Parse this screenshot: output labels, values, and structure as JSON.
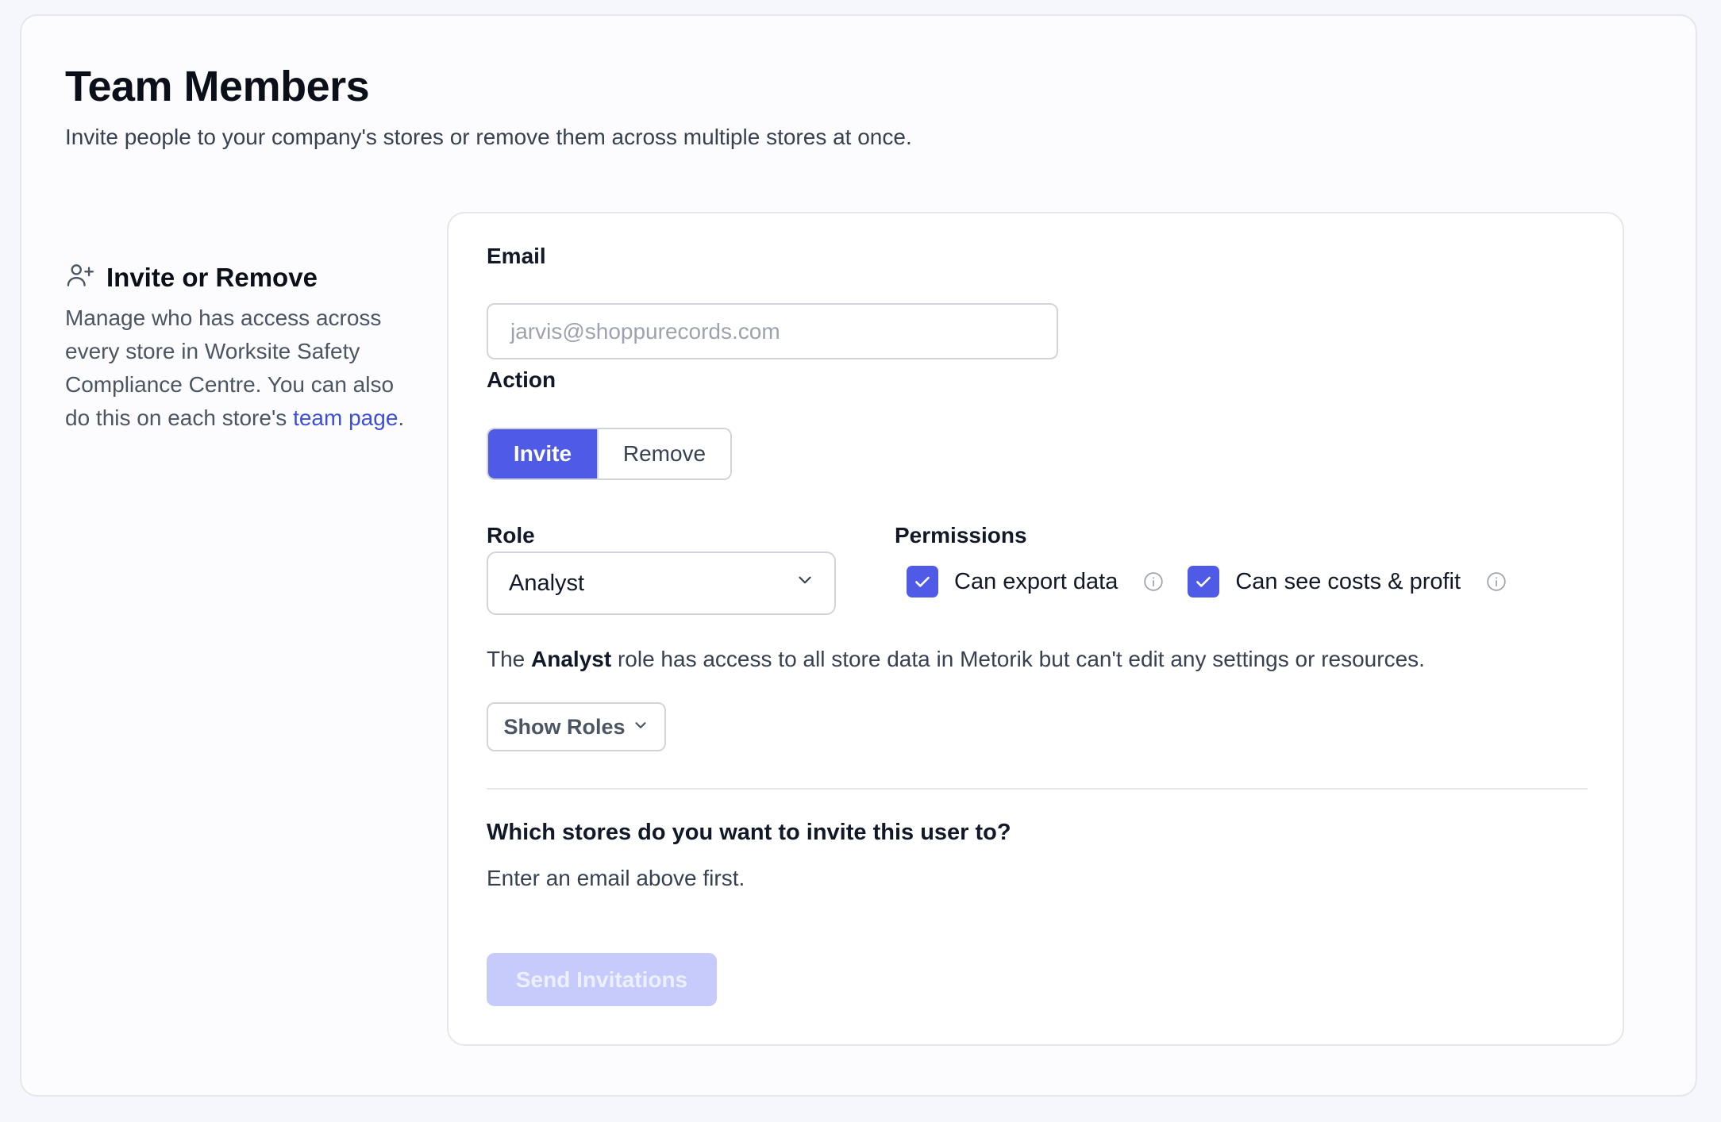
{
  "header": {
    "title": "Team Members",
    "subtitle": "Invite people to your company's stores or remove them across multiple stores at once."
  },
  "sidebar": {
    "icon": "user-plus-icon",
    "title": "Invite or Remove",
    "description_prefix": "Manage who has access across every store in Worksite Safety Compliance Centre. You can also do this on each store's ",
    "link_text": "team page",
    "description_suffix": "."
  },
  "form": {
    "email": {
      "label": "Email",
      "placeholder": "jarvis@shoppurecords.com",
      "value": ""
    },
    "action": {
      "label": "Action",
      "options": [
        "Invite",
        "Remove"
      ],
      "selected": "Invite"
    },
    "role": {
      "label": "Role",
      "selected": "Analyst"
    },
    "permissions": {
      "label": "Permissions",
      "items": [
        {
          "label": "Can export data",
          "checked": true
        },
        {
          "label": "Can see costs & profit",
          "checked": true
        }
      ]
    },
    "role_description": {
      "prefix": "The ",
      "role": "Analyst",
      "suffix": " role has access to all store data in Metorik but can't edit any settings or resources."
    },
    "show_roles_label": "Show Roles",
    "stores_question": "Which stores do you want to invite this user to?",
    "stores_hint": "Enter an email above first.",
    "submit_label": "Send Invitations"
  },
  "colors": {
    "accent": "#4f5be6",
    "link": "#3b4fd8",
    "submit_disabled": "#c7cbfb"
  }
}
